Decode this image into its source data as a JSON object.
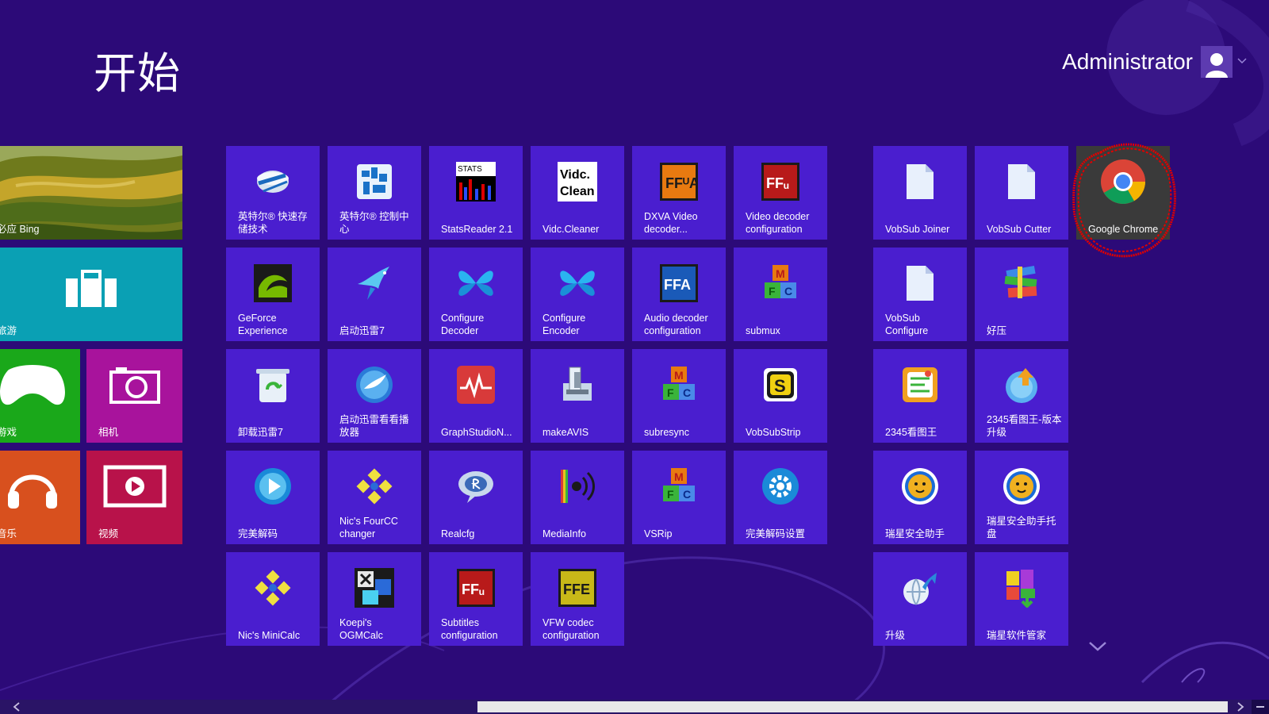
{
  "screen": {
    "title": "开始"
  },
  "user": {
    "name": "Administrator"
  },
  "tiles_left": [
    {
      "key": "bing",
      "label": "必应 Bing"
    },
    {
      "key": "travel",
      "label": "旅游"
    },
    {
      "key": "games",
      "label": "游戏"
    },
    {
      "key": "camera",
      "label": "相机"
    },
    {
      "key": "music",
      "label": "音乐"
    },
    {
      "key": "video",
      "label": "视频"
    }
  ],
  "tiles_group1": [
    [
      "英特尔® 快速存储技术",
      "英特尔® 控制中心",
      "StatsReader 2.1",
      "Vidc.Cleaner",
      "DXVA Video decoder...",
      "Video decoder configuration"
    ],
    [
      "GeForce Experience",
      "启动迅雷7",
      "Configure Decoder",
      "Configure Encoder",
      "Audio decoder configuration",
      "submux"
    ],
    [
      "卸载迅雷7",
      "启动迅雷看看播放器",
      "GraphStudioN...",
      "makeAVIS",
      "subresync",
      "VobSubStrip"
    ],
    [
      "完美解码",
      "Nic's FourCC changer",
      "Realcfg",
      "MediaInfo",
      "VSRip",
      "完美解码设置"
    ],
    [
      "Nic's MiniCalc",
      "Koepi's OGMCalc",
      "Subtitles configuration",
      "VFW codec configuration"
    ]
  ],
  "tiles_group2": [
    [
      "VobSub Joiner",
      "VobSub Cutter",
      "Google Chrome"
    ],
    [
      "VobSub Configure",
      "好压"
    ],
    [
      "2345看图王",
      "2345看图王-版本升级"
    ],
    [
      "瑞星安全助手",
      "瑞星安全助手托盘"
    ],
    [
      "升级",
      "瑞星软件管家"
    ]
  ],
  "icon_text": {
    "stats": "STATS",
    "vidc_line1": "Vidc.",
    "vidc_line2": "Clean",
    "ffua": "FFᵁA",
    "ffu": "FFᵤ",
    "ffa": "FFA",
    "ffe": "FFE",
    "m": "M",
    "f": "F",
    "c": "C",
    "s": "S"
  },
  "colors": {
    "background": "#2c0a78",
    "tile": "#4a1ecf",
    "travel": "#0aa0b4",
    "games": "#1aa81a",
    "camera": "#a8139c",
    "music": "#d8501e",
    "video": "#b8124a",
    "chrome_tile": "#3a3a3a",
    "highlight_circle": "#e00000"
  }
}
